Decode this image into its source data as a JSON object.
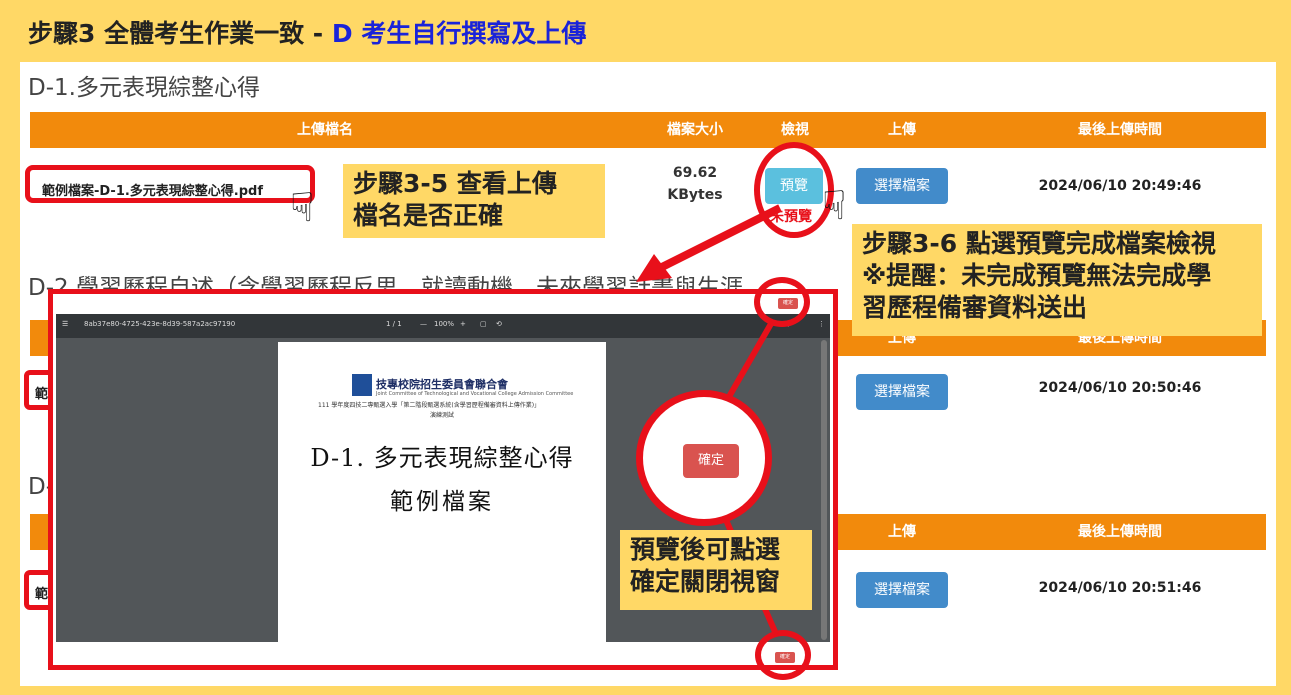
{
  "step_title_prefix": "步驟3 全體考生作業一致 - ",
  "step_title_highlight": "D 考生自行撰寫及上傳",
  "section1": {
    "title": "D-1.多元表現綜整心得"
  },
  "section2": {
    "title": "D-2.學習歷程自述（含學習歷程反思、就讀動機、未來學習計畫與生涯"
  },
  "section3": {
    "title": "D-"
  },
  "headers": {
    "filename": "上傳檔名",
    "size": "檔案大小",
    "view": "檢視",
    "upload": "上傳",
    "last_time": "最後上傳時間"
  },
  "row1": {
    "file": "範例檔案-D-1.多元表現綜整心得.pdf",
    "size_value": "69.62",
    "size_unit": "KBytes",
    "preview": "預覽",
    "not_previewed": "未預覽",
    "choose": "選擇檔案",
    "time": "2024/06/10 20:49:46"
  },
  "row2": {
    "file_prefix": "範",
    "choose": "選擇檔案",
    "time": "2024/06/10 20:50:46"
  },
  "row3": {
    "file_prefix": "範",
    "choose": "選擇檔案",
    "time": "2024/06/10 20:51:46"
  },
  "callouts": {
    "c1_line1": "步驟3-5 查看上傳",
    "c1_line2": "檔名是否正確",
    "c2_line1": "步驟3-6 點選預覽完成檔案檢視",
    "c2_line2": "※提醒：未完成預覽無法完成學",
    "c2_line3": "習歷程備審資料送出",
    "c3_line1": "預覽後可點選",
    "c3_line2": "確定關閉視窗"
  },
  "modal": {
    "top_confirm": "確定",
    "bottom_confirm": "確定",
    "zoom_confirm": "確定",
    "viewer": {
      "doc_id": "8ab37e80-4725-423e-8d39-587a2ac97190",
      "page": "1 / 1",
      "zoom": "100%"
    },
    "doc": {
      "org": "技專校院招生委員會聯合會",
      "org_en": "Joint Committee of Technological and Vocational College Admission Committee",
      "subtitle": "111 學年度四技二專甄選入學「第二階段甄選系統(含學習歷程備審資料上傳作業)」",
      "note": "演練測試",
      "title": "D-1. 多元表現綜整心得",
      "subtitle2": "範例檔案"
    }
  },
  "colors": {
    "header": "#f28a0c",
    "highlight_red": "#e8101a",
    "callout_bg": "#ffd866",
    "preview_btn": "#5bc0de",
    "choose_btn": "#428bca"
  }
}
